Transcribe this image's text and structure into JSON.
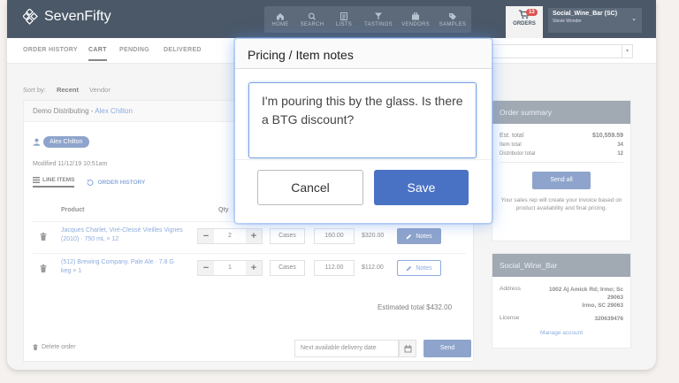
{
  "app": {
    "brand": "SevenFifty"
  },
  "nav": {
    "items": [
      {
        "label": "HOME",
        "icon": "home-icon"
      },
      {
        "label": "SEARCH",
        "icon": "search-icon"
      },
      {
        "label": "LISTS",
        "icon": "list-icon"
      },
      {
        "label": "TASTINGS",
        "icon": "tasting-icon"
      },
      {
        "label": "VENDORS",
        "icon": "vendor-icon"
      },
      {
        "label": "SAMPLES",
        "icon": "tag-icon"
      }
    ],
    "orders_label": "ORDERS",
    "cart_count": "13"
  },
  "user": {
    "name": "Social_Wine_Bar (SC)",
    "subname": "Stevie Wonder"
  },
  "subnav": {
    "tabs": [
      "ORDER HISTORY",
      "CART",
      "PENDING",
      "DELIVERED"
    ],
    "active": "CART"
  },
  "sort": {
    "label": "Sort by:",
    "options": [
      "Recent",
      "Vendor"
    ],
    "selected": "Recent"
  },
  "cart": {
    "distributor": "Demo Distributing",
    "separator": " - ",
    "rep": "Alex Chilton",
    "modified": "Modified 11/12/19 10:51am",
    "tabs": {
      "line_items": "LINE ITEMS",
      "order_history": "ORDER HISTORY"
    },
    "columns": {
      "product": "Product",
      "qty": "Qty"
    },
    "rows": [
      {
        "product": "Jacques Charlet, Viré-Clessé Vieilles Vignes (2010) · 750 mL × 12",
        "qty": "2",
        "unit": "Cases",
        "price": "160.00",
        "total": "$320.00",
        "notes": "Notes"
      },
      {
        "product": "(512) Brewing Company, Pale Ale · 7.8 G keg × 1",
        "qty": "1",
        "unit": "Cases",
        "price": "112.00",
        "total": "$112.00",
        "notes": "Notes"
      }
    ],
    "estimated_total": "Estimated total $432.00",
    "delete_label": "Delete order",
    "delivery_placeholder": "Next available delivery date",
    "send_label": "Send"
  },
  "summary": {
    "title": "Order summary",
    "est_label": "Est. total",
    "est_value": "$10,559.59",
    "item_label": "Item total",
    "item_value": "34",
    "dist_label": "Distributor total",
    "dist_value": "12",
    "send_all": "Send all",
    "note": "Your sales rep will create your invoice based on product availability and final pricing."
  },
  "account": {
    "title": "Social_Wine_Bar",
    "address_label": "Address",
    "address_line1": "1002 Aj Amick Rd; Irmo; Sc",
    "address_line2": "29063",
    "address_line3": "Irmo, SC 29063",
    "license_label": "License",
    "license_value": "320639476",
    "manage": "Manage account"
  },
  "modal": {
    "title": "Pricing / Item notes",
    "note_text": "I'm pouring this by the glass. Is there a BTG discount?",
    "cancel": "Cancel",
    "save": "Save"
  },
  "colors": {
    "header": "#4a5868",
    "accent": "#3d63a8",
    "link": "#3a6fc4"
  }
}
